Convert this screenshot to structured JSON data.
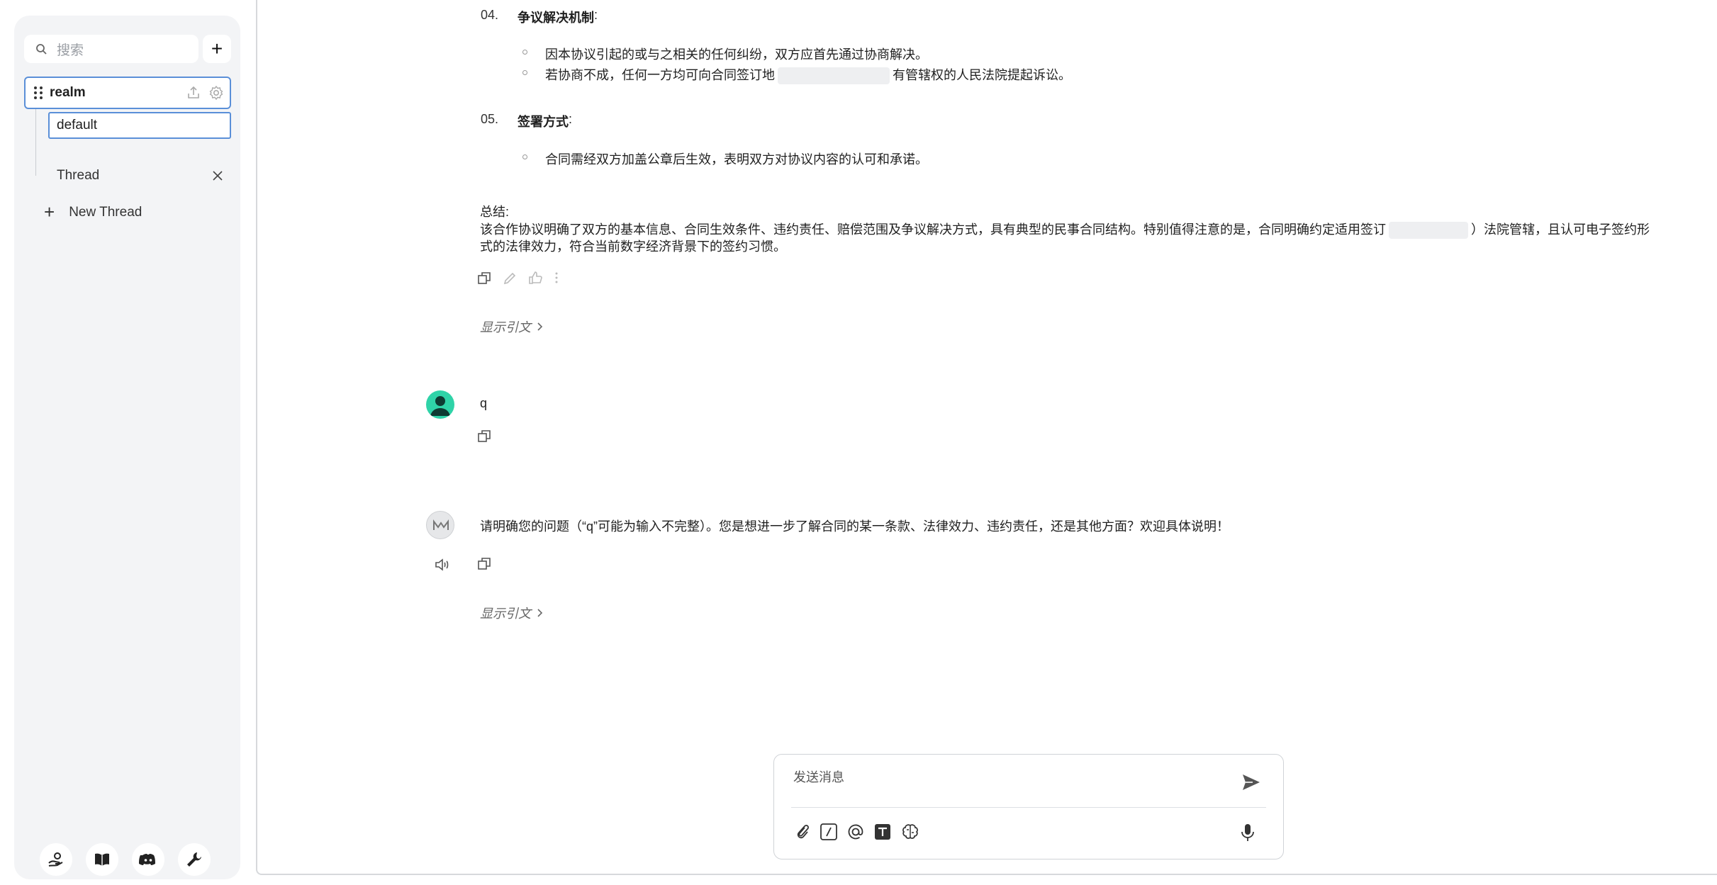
{
  "sidebar": {
    "search_placeholder": "搜索",
    "add_label": "+",
    "realm": {
      "name": "realm"
    },
    "default_item": "default",
    "thread_item": "Thread",
    "new_thread": "New Thread",
    "bottom_icons": [
      "hand-coin-icon",
      "book-icon",
      "discord-icon",
      "wrench-icon"
    ]
  },
  "message_top": {
    "item04": {
      "number": "04.",
      "title": "争议解决机制",
      "colon": ":"
    },
    "item04_bullets": [
      "因本协议引起的或与之相关的任何纠纷，双方应首先通过协商解决。",
      {
        "before": "若协商不成，任何一方均可向合同签订地",
        "after": "有管辖权的人民法院提起诉讼。"
      }
    ],
    "item05": {
      "number": "05.",
      "title": "签署方式",
      "colon": ":"
    },
    "item05_bullets": [
      "合同需经双方加盖公章后生效，表明双方对协议内容的认可和承诺。"
    ],
    "summary_label": "总结:",
    "summary_line1_before": "该合作协议明确了双方的基本信息、合同生效条件、违约责任、赔偿范围及争议解决方式，具有典型的民事合同结构。特别值得注意的是，合同明确约定适用签订",
    "summary_line1_after": "）法院管辖，且认可电子签约形",
    "summary_line2": "式的法律效力，符合当前数字经济背景下的签约习惯。",
    "show_citation": "显示引文"
  },
  "user_message": {
    "text": "q"
  },
  "assistant_message": {
    "text": "请明确您的问题（“q”可能为输入不完整）。您是想进一步了解合同的某一条款、法律效力、违约责任，还是其他方面？欢迎具体说明！",
    "show_citation": "显示引文"
  },
  "composer": {
    "placeholder": "发送消息"
  },
  "colors": {
    "accent": "#5a8fd8",
    "user_avatar": "#2fd3a8",
    "sidebar_bg": "#f3f4f6"
  }
}
